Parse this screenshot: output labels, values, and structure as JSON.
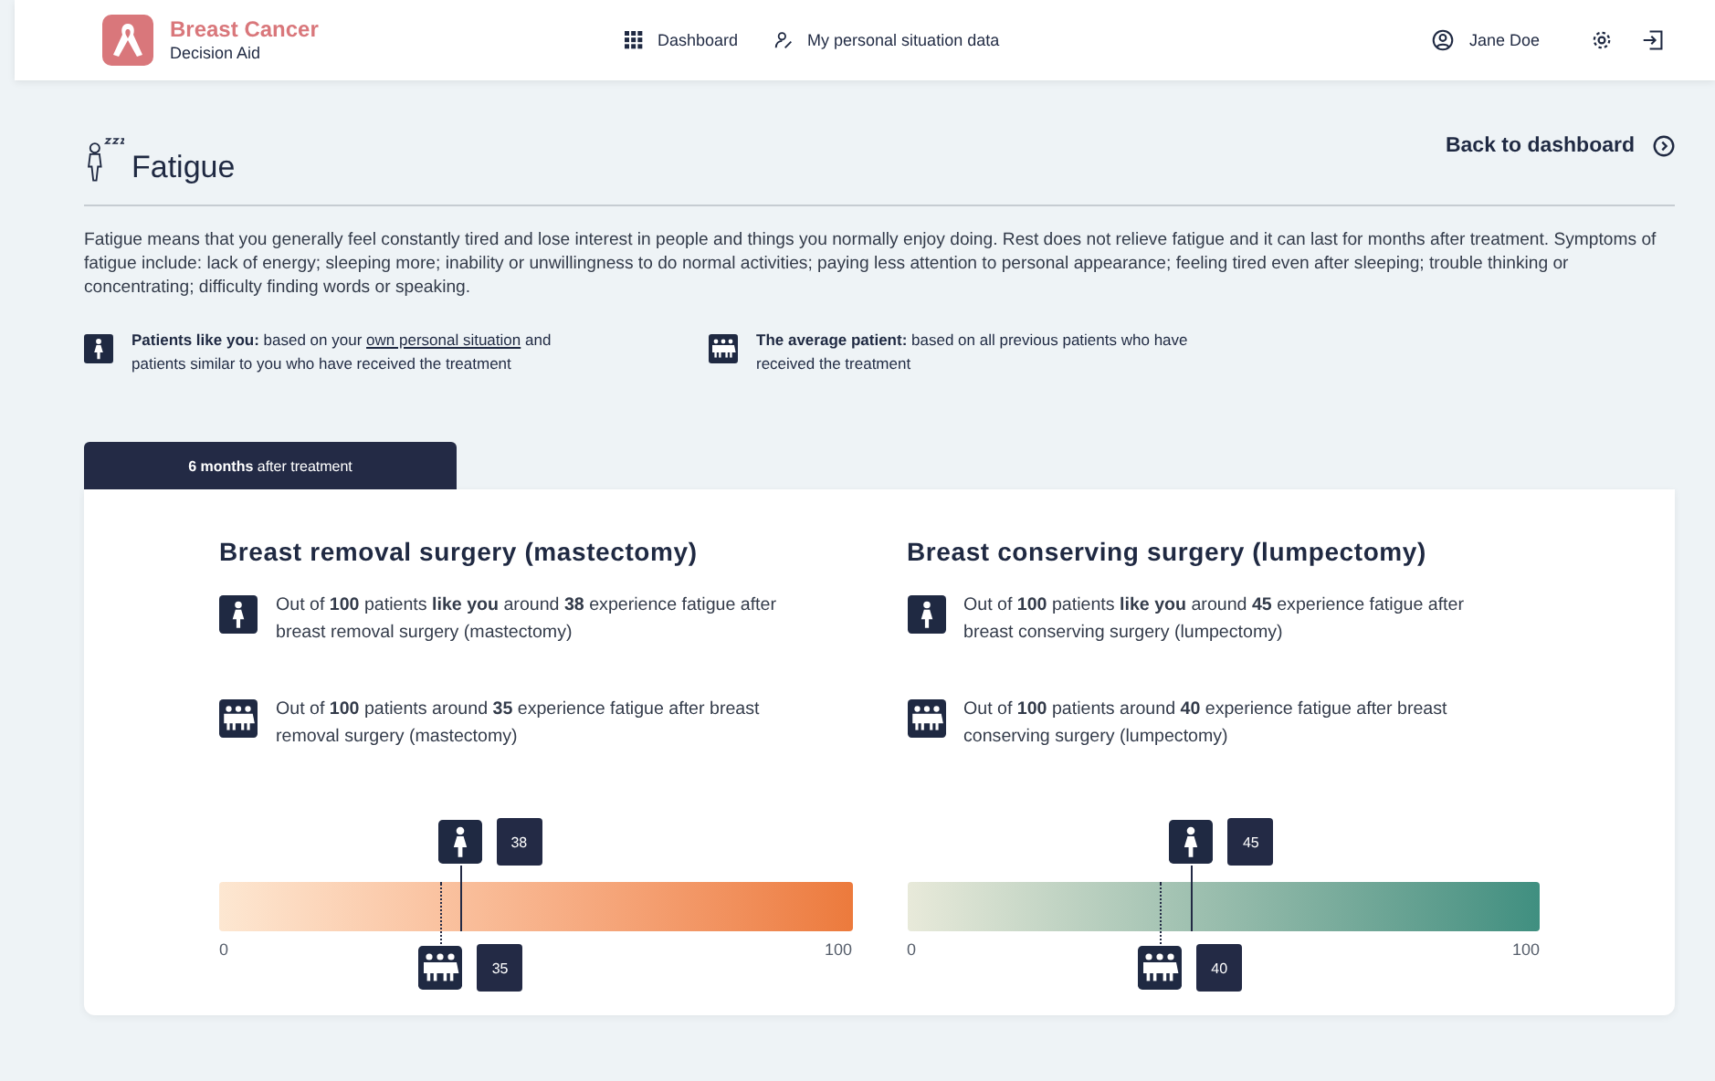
{
  "header": {
    "logo_title": "Breast Cancer",
    "logo_subtitle": "Decision Aid",
    "nav": [
      {
        "label": "Dashboard",
        "kind": "grid"
      },
      {
        "label": "My personal situation data",
        "kind": "profile"
      }
    ],
    "user": "Jane Doe"
  },
  "page": {
    "title": "Fatigue",
    "back_link": "Back to dashboard",
    "description": "Fatigue means that you generally feel constantly tired and lose interest in people and things you normally enjoy doing. Rest does not relieve fatigue and it can last for months after treatment. Symptoms of fatigue include: lack of energy; sleeping more; inability or unwillingness to do normal activities; paying less attention to personal appearance; feeling tired even after sleeping; trouble thinking or concentrating; difficulty finding words or speaking.",
    "legend": [
      {
        "kind": "you",
        "lead": "Patients like you:",
        "before": " based on your ",
        "link": "own personal situation",
        "after": " and patients similar to you who have received the treatment"
      },
      {
        "kind": "average",
        "lead": "The average patient:",
        "before": " based on all previous patients who have received the treatment"
      }
    ]
  },
  "tabs": [
    {
      "label": "**6 months** after treatment",
      "selected": true
    }
  ],
  "options": [
    {
      "title": "Breast removal surgery (mastectomy)",
      "color": "#ec7a3c",
      "scale_min": "0",
      "scale_max": "100",
      "you": {
        "text": "Out of **100** patients **like you** around **38** experience fatigue after breast removal surgery (mastectomy)",
        "value": "38",
        "level": 0.38
      },
      "average": {
        "text": "Out of **100** patients around **35** experience fatigue after breast removal surgery (mastectomy)",
        "value": "35",
        "level": 0.35
      }
    },
    {
      "title": "Breast conserving surgery (lumpectomy)",
      "color": "#3f8f80",
      "scale_min": "0",
      "scale_max": "100",
      "you": {
        "text": "Out of **100** patients **like you** around **45** experience fatigue after breast conserving surgery (lumpectomy)",
        "value": "45",
        "level": 0.45
      },
      "average": {
        "text": "Out of **100** patients around **40** experience fatigue after breast conserving surgery (lumpectomy)",
        "value": "40",
        "level": 0.4
      }
    }
  ]
}
